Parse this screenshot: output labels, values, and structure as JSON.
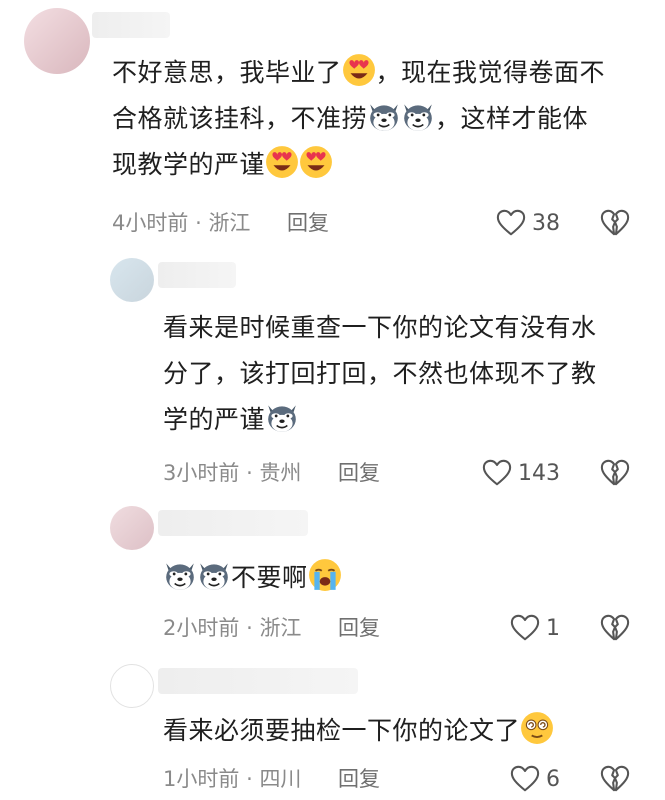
{
  "comments": [
    {
      "text_lines": [
        "不好意思，我毕业了",
        "，现在我觉得卷面不",
        "合格就该挂科，不准捞",
        "，这样才能体",
        "现教学的严谨"
      ],
      "time": "4小时前",
      "location": "浙江",
      "reply_label": "回复",
      "likes": "38"
    },
    {
      "text_lines": [
        "看来是时候重查一下你的论文有没有水",
        "分了，该打回打回，不然也体现不了教",
        "学的严谨"
      ],
      "time": "3小时前",
      "location": "贵州",
      "reply_label": "回复",
      "likes": "143"
    },
    {
      "text_lines": [
        "不要啊"
      ],
      "time": "2小时前",
      "location": "浙江",
      "reply_label": "回复",
      "likes": "1"
    },
    {
      "text_lines": [
        "看来必须要抽检一下你的论文了"
      ],
      "time": "1小时前",
      "location": "四川",
      "reply_label": "回复",
      "likes": "6"
    }
  ],
  "separator": "·",
  "icons": {
    "like": "heart-outline-icon",
    "dislike": "broken-heart-icon",
    "emoji_heart_eyes": "heart-eyes-emoji-icon",
    "emoji_dog": "dog-face-emoji-icon",
    "emoji_cry": "loudly-crying-emoji-icon",
    "emoji_dizzy": "dizzy-face-emoji-icon"
  },
  "colors": {
    "text": "#1f1f1f",
    "meta": "#8a8a8a",
    "icon": "#555555"
  }
}
